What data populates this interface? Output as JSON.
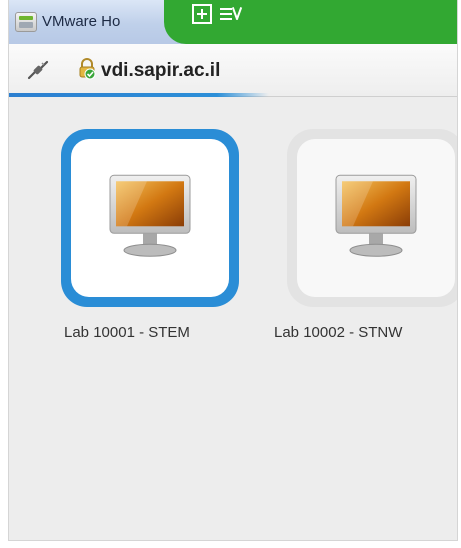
{
  "window": {
    "title": "VMware Ho"
  },
  "toolbar": {
    "server": "vdi.sapir.ac.il"
  },
  "desktops": [
    {
      "label": "Lab 10001 - STEM",
      "selected": true
    },
    {
      "label": "Lab 10002 - STNW",
      "selected": false
    }
  ],
  "colors": {
    "selection": "#2a8dd6",
    "banner_green": "#32a832",
    "background": "#ededed"
  },
  "icons": {
    "app": "vmware-horizon-icon",
    "connection": "plug-icon",
    "security": "secure-connection-icon",
    "desktop": "monitor-icon"
  }
}
